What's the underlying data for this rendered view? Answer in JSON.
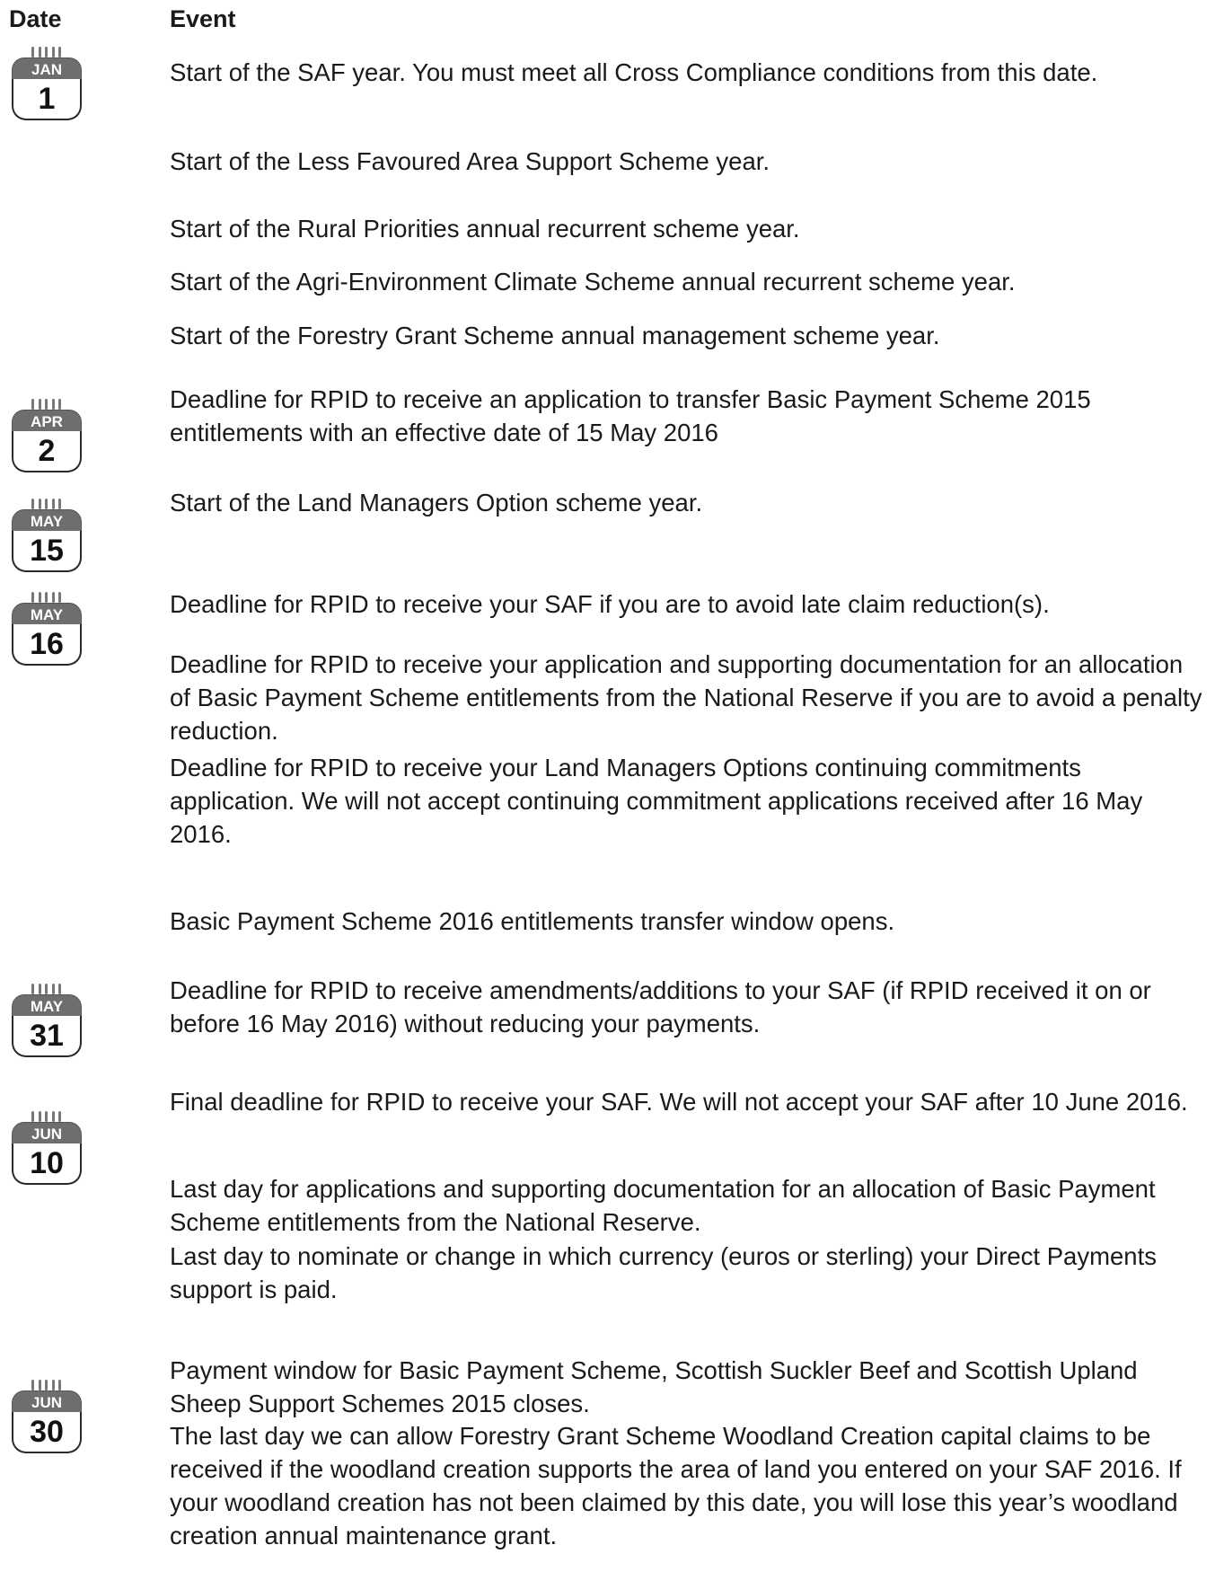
{
  "header": {
    "date_label": "Date",
    "event_label": "Event"
  },
  "entries": [
    {
      "month": "JAN",
      "day": "1",
      "events": [
        "Start of the SAF year. You must meet all Cross Compliance conditions from this date.",
        "Start of the Less Favoured Area Support Scheme year.",
        "Start of the Rural Priorities annual recurrent scheme year.",
        "Start of the Agri-Environment Climate Scheme annual recurrent scheme year.",
        "Start of the Forestry Grant Scheme annual management scheme year."
      ]
    },
    {
      "month": "APR",
      "day": "2",
      "events": [
        "Deadline for RPID to receive an application to transfer Basic Payment Scheme 2015 entitlements with an effective date of 15 May 2016"
      ]
    },
    {
      "month": "MAY",
      "day": "15",
      "events": [
        "Start of the Land Managers Option scheme year."
      ]
    },
    {
      "month": "MAY",
      "day": "16",
      "events": [
        "Deadline for RPID to receive your SAF if you are to avoid late claim reduction(s).",
        "Deadline for RPID to receive your application and supporting documentation for an allocation of Basic Payment Scheme entitlements from the National Reserve if you are to avoid a penalty reduction.",
        "Deadline for RPID to receive your Land Managers Options continuing commitments application. We will not accept continuing commitment applications received after 16 May 2016.",
        "Basic Payment Scheme 2016 entitlements transfer window opens."
      ]
    },
    {
      "month": "MAY",
      "day": "31",
      "events": [
        "Deadline for RPID to receive amendments/additions to your SAF (if RPID received it on or before 16 May 2016) without reducing your payments."
      ]
    },
    {
      "month": "JUN",
      "day": "10",
      "events": [
        "Final deadline for RPID to receive your SAF. We will not accept your SAF after 10 June 2016.",
        "Last day for applications and supporting documentation for an allocation of Basic Payment Scheme entitlements from the National Reserve.",
        "Last day to nominate or change in which currency (euros or sterling) your Direct Payments support is paid."
      ]
    },
    {
      "month": "JUN",
      "day": "30",
      "events": [
        "Payment window for Basic Payment Scheme, Scottish Suckler Beef and Scottish Upland Sheep Support Schemes 2015 closes.",
        "The last day we can allow Forestry Grant Scheme Woodland Creation capital claims to be received if the woodland creation supports the area of land you entered on your SAF 2016. If your woodland creation has not been claimed by this date, you will lose this year’s woodland creation annual maintenance grant."
      ]
    }
  ]
}
